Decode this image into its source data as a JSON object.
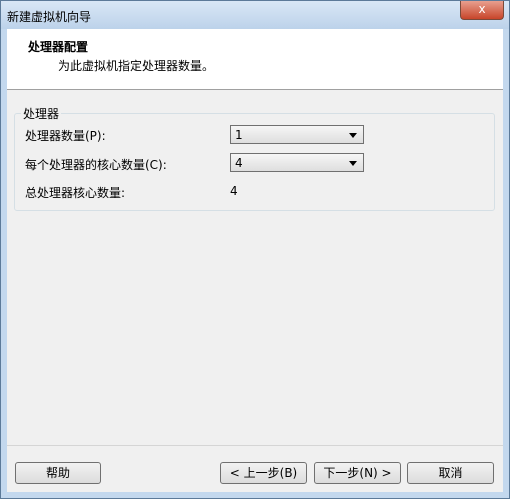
{
  "window": {
    "title": "新建虚拟机向导",
    "close_label": "x"
  },
  "header": {
    "title": "处理器配置",
    "subtitle": "为此虚拟机指定处理器数量。"
  },
  "group": {
    "label": "处理器",
    "processors_label": "处理器数量(P):",
    "processors_value": "1",
    "cores_label": "每个处理器的核心数量(C):",
    "cores_value": "4",
    "total_label": "总处理器核心数量:",
    "total_value": "4"
  },
  "buttons": {
    "help": "帮助",
    "back": "< 上一步(B)",
    "next": "下一步(N) >",
    "cancel": "取消"
  }
}
